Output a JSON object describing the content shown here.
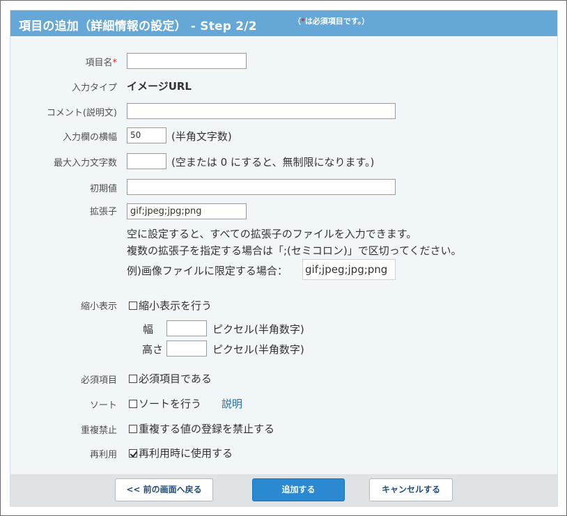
{
  "header": {
    "title": "項目の追加（詳細情報の設定） - Step 2/2",
    "note_open": "（",
    "note_star": "*",
    "note_text": "は必須項目です。）"
  },
  "form": {
    "name": {
      "label": "項目名",
      "required_mark": "*",
      "value": ""
    },
    "input_type": {
      "label": "入力タイプ",
      "value": "イメージURL"
    },
    "comment": {
      "label": "コメント(説明文)",
      "value": ""
    },
    "width": {
      "label": "入力欄の横幅",
      "value": "50",
      "suffix": "(半角文字数)"
    },
    "max_chars": {
      "label": "最大入力文字数",
      "value": "",
      "suffix": "(空または 0 にすると、無制限になります。)"
    },
    "initial": {
      "label": "初期値",
      "value": ""
    },
    "extension": {
      "label": "拡張子",
      "value": "gif;jpeg;jpg;png",
      "help1": "空に設定すると、すべての拡張子のファイルを入力できます。",
      "help2": "複数の拡張子を指定する場合は「;(セミコロン)」で区切ってください。",
      "example_label": "例)画像ファイルに限定する場合：",
      "example_value": "gif;jpeg;jpg;png"
    },
    "thumbnail": {
      "label": "縮小表示",
      "checkbox_label": "縮小表示を行う",
      "checked": false,
      "width_label": "幅",
      "width_value": "",
      "width_suffix": "ピクセル(半角数字)",
      "height_label": "高さ",
      "height_value": "",
      "height_suffix": "ピクセル(半角数字)"
    },
    "required": {
      "label": "必須項目",
      "checkbox_label": "必須項目である",
      "checked": false
    },
    "sort": {
      "label": "ソート",
      "checkbox_label": "ソートを行う",
      "checked": false,
      "link": "説明"
    },
    "duplicate": {
      "label": "重複禁止",
      "checkbox_label": "重複する値の登録を禁止する",
      "checked": false
    },
    "reuse": {
      "label": "再利用",
      "checkbox_label": "再利用時に使用する",
      "checked": true
    }
  },
  "footer": {
    "back_label": "<< 前の画面へ戻る",
    "add_label": "追加する",
    "cancel_label": "キャンセルする"
  }
}
